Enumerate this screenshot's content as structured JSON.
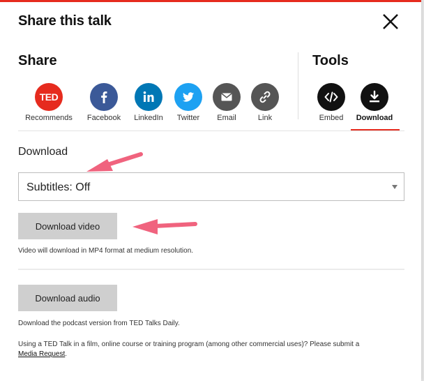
{
  "modal": {
    "title": "Share this talk",
    "close_icon": "close-icon"
  },
  "share": {
    "title": "Share",
    "options": [
      {
        "label": "Recommends",
        "icon": "ted-logo-icon",
        "color": "#e62b1e"
      },
      {
        "label": "Facebook",
        "icon": "facebook-icon",
        "color": "#3b5998"
      },
      {
        "label": "LinkedIn",
        "icon": "linkedin-icon",
        "color": "#0077b5"
      },
      {
        "label": "Twitter",
        "icon": "twitter-icon",
        "color": "#1da1f2"
      },
      {
        "label": "Email",
        "icon": "email-icon",
        "color": "#555555"
      },
      {
        "label": "Link",
        "icon": "link-icon",
        "color": "#555555"
      }
    ],
    "ted_logo_text": "TED"
  },
  "tools": {
    "title": "Tools",
    "options": [
      {
        "label": "Embed",
        "icon": "embed-code-icon",
        "color": "#111111"
      },
      {
        "label": "Download",
        "icon": "download-icon",
        "color": "#111111",
        "active": true
      }
    ]
  },
  "download": {
    "label": "Download",
    "subtitles_select": {
      "value": "Subtitles: Off"
    },
    "video_button": "Download video",
    "video_note": "Video will download in MP4 format at medium resolution.",
    "audio_button": "Download audio",
    "audio_note": "Download the podcast version from TED Talks Daily.",
    "commercial_note": "Using a TED Talk in a film, online course or training program (among other commercial uses)? Please submit a",
    "media_request_link": "Media Request",
    "trailing_period": "."
  },
  "colors": {
    "accent": "#e62b1e",
    "annotation_arrow": "#f0637e",
    "button_bg": "#cfcfcf"
  }
}
